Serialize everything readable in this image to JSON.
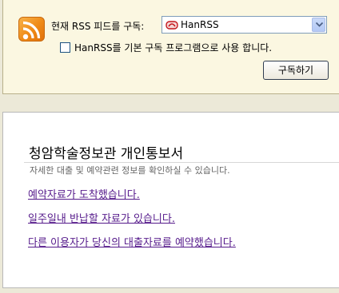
{
  "rss": {
    "subscribe_label": "현재 RSS 피드를 구독:",
    "reader_selected": "HanRSS",
    "default_checkbox_label": "HanRSS를 기본 구독 프로그램으로 사용 합니다.",
    "default_checked": false,
    "subscribe_button": "구독하기",
    "icon": "rss-feed-icon"
  },
  "notice": {
    "title": "청암학술정보관 개인통보서",
    "description": "자세한 대출 및 예약관련 정보를 확인하실 수 있습니다.",
    "links": [
      "예약자료가 도착했습니다.",
      "일주일내 반납할 자료가 있습니다.",
      "다른 이용자가 당신의 대출자료를 예약했습니다."
    ]
  },
  "colors": {
    "rss_panel_bg": "#fbf7e1",
    "rss_orange": "#ef8a16",
    "visited_link": "#551a8b"
  }
}
